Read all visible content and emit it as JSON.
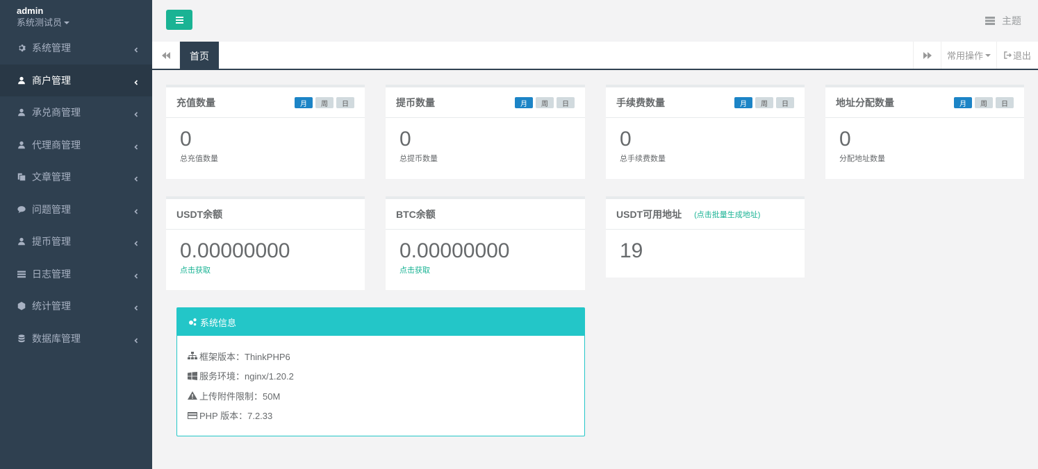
{
  "profile": {
    "name": "admin",
    "role": "系统测试员"
  },
  "sidebar": {
    "items": [
      {
        "label": "系统管理",
        "icon": "gear-icon"
      },
      {
        "label": "商户管理",
        "icon": "user-icon",
        "active": true
      },
      {
        "label": "承兑商管理",
        "icon": "user-icon"
      },
      {
        "label": "代理商管理",
        "icon": "user-icon"
      },
      {
        "label": "文章管理",
        "icon": "copy-icon"
      },
      {
        "label": "问题管理",
        "icon": "comment-icon"
      },
      {
        "label": "提币管理",
        "icon": "user-icon"
      },
      {
        "label": "日志管理",
        "icon": "list-icon"
      },
      {
        "label": "统计管理",
        "icon": "cube-icon"
      },
      {
        "label": "数据库管理",
        "icon": "database-icon"
      }
    ]
  },
  "topbar": {
    "theme_label": "主题"
  },
  "tabbar": {
    "home_tab": "首页",
    "ops_label": "常用操作",
    "exit_label": "退出"
  },
  "badges": {
    "month": "月",
    "week": "周",
    "day": "日"
  },
  "stats": [
    {
      "title": "充值数量",
      "value": "0",
      "caption": "总充值数量"
    },
    {
      "title": "提币数量",
      "value": "0",
      "caption": "总提币数量"
    },
    {
      "title": "手续费数量",
      "value": "0",
      "caption": "总手续费数量"
    },
    {
      "title": "地址分配数量",
      "value": "0",
      "caption": "分配地址数量"
    }
  ],
  "balances": [
    {
      "title": "USDT余额",
      "value": "0.00000000",
      "link": "点击获取"
    },
    {
      "title": "BTC余额",
      "value": "0.00000000",
      "link": "点击获取"
    }
  ],
  "usdt_address": {
    "title": "USDT可用地址",
    "hint": "(点击批量生成地址)",
    "value": "19"
  },
  "system_info": {
    "title": "系统信息",
    "rows": [
      {
        "icon": "sitemap-icon",
        "text": "框架版本：ThinkPHP6"
      },
      {
        "icon": "windows-icon",
        "text": "服务环境：nginx/1.20.2"
      },
      {
        "icon": "warning-icon",
        "text": "上传附件限制：50M"
      },
      {
        "icon": "credit-card-icon",
        "text": "PHP 版本：7.2.33"
      }
    ]
  },
  "colors": {
    "sidebar": "#2f4050",
    "primary": "#1ab394",
    "info": "#23c6c8",
    "badge_active": "#1c84c6"
  }
}
